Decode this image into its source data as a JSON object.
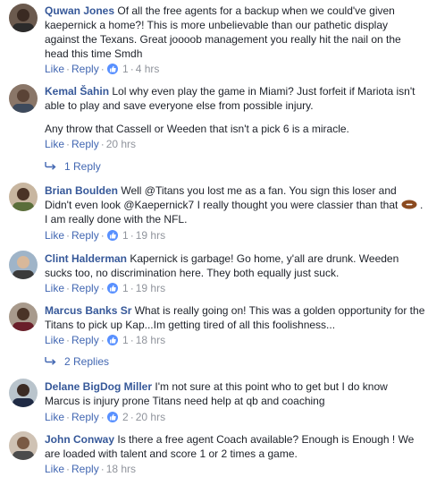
{
  "actions": {
    "like": "Like",
    "reply": "Reply",
    "sep": "·"
  },
  "comments": [
    {
      "name": "Quwan Jones",
      "text": "Of all the free agents for a backup when we could've given kaepernick a home?! This is more unbelievable than our pathetic display against the Texans. Great joooob management you really hit the nail on the head this time Smdh",
      "likes": "1",
      "time": "4 hrs"
    },
    {
      "name": "Kemal Šahin",
      "text": "Lol why even play the game in Miami? Just forfeit if Mariota isn't able to play and save everyone else from possible injury.",
      "text2": "Any throw that Cassell or Weeden that isn't a pick 6 is a miracle.",
      "time": "20 hrs",
      "replies": "1 Reply"
    },
    {
      "name": "Brian Boulden",
      "text": "Well @Titans you lost me as a fan. You sign this loser and Didn't even look @Kaepernick7 I really thought you were classier than that",
      "text_after": ". I am really done with the NFL.",
      "likes": "1",
      "time": "19 hrs"
    },
    {
      "name": "Clint Halderman",
      "text": "Kapernick is garbage! Go home, y'all are drunk. Weeden sucks too, no discrimination here. They both equally just suck.",
      "likes": "1",
      "time": "19 hrs"
    },
    {
      "name": "Marcus Banks Sr",
      "text": "What is really going on! This was a golden opportunity for the Titans to pick up Kap...Im getting tired of all this foolishness...",
      "likes": "1",
      "time": "18 hrs",
      "replies": "2 Replies"
    },
    {
      "name": "Delane BigDog Miller",
      "text": "I'm not sure at this point who to get but I do know Marcus is injury prone Titans need help at qb and coaching",
      "likes": "2",
      "time": "20 hrs"
    },
    {
      "name": "John Conway",
      "text": "Is there a free agent Coach available? Enough is Enough ! We are loaded with talent and score 1 or 2 times a game.",
      "time": "18 hrs"
    }
  ]
}
